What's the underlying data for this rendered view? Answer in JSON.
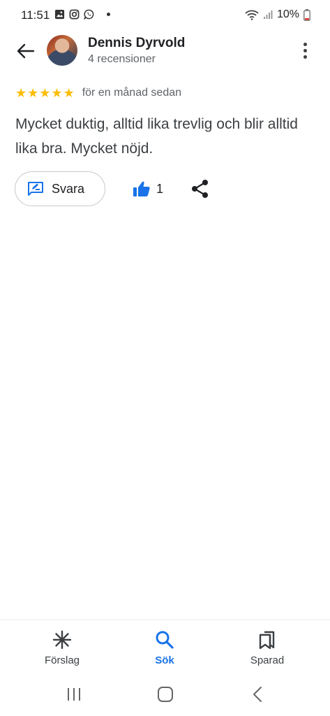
{
  "status_bar": {
    "time": "11:51",
    "battery": "10%",
    "icons": [
      "gallery-icon",
      "instagram-icon",
      "whatsapp-icon",
      "notification-dot",
      "wifi-icon",
      "signal-icon",
      "battery-icon"
    ]
  },
  "header": {
    "reviewer_name": "Dennis Dyrvold",
    "review_count": "4 recensioner"
  },
  "review": {
    "rating": 5,
    "stars": [
      "★",
      "★",
      "★",
      "★",
      "★"
    ],
    "date": "för en månad sedan",
    "text": "Mycket duktig, alltid lika trevlig och blir alltid lika bra. Mycket nöjd."
  },
  "actions": {
    "reply_label": "Svara",
    "like_count": "1"
  },
  "bottom_nav": {
    "items": [
      {
        "label": "Förslag",
        "icon": "sparkle-icon",
        "active": false
      },
      {
        "label": "Sök",
        "icon": "search-icon",
        "active": true
      },
      {
        "label": "Sparad",
        "icon": "bookmarks-icon",
        "active": false
      }
    ]
  },
  "colors": {
    "accent": "#1a73e8",
    "star": "#fbbc04",
    "text_primary": "#202124",
    "text_secondary": "#5f6368"
  }
}
